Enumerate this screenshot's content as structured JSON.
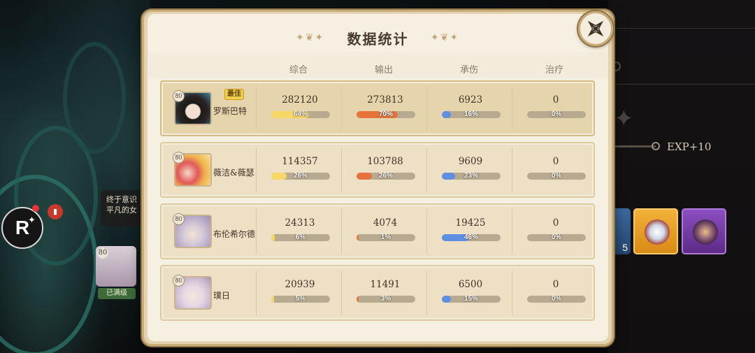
{
  "panel": {
    "title": "数据统计",
    "columns": [
      "综合",
      "输出",
      "承伤",
      "治疗"
    ],
    "best_label": "最佳",
    "rows": [
      {
        "name": "罗斯巴特",
        "level": "80",
        "best": true,
        "stats": [
          {
            "value": "282120",
            "pct": "64%",
            "fraction": 0.64,
            "color": "yellow"
          },
          {
            "value": "273813",
            "pct": "70%",
            "fraction": 0.7,
            "color": "orange"
          },
          {
            "value": "6923",
            "pct": "16%",
            "fraction": 0.16,
            "color": "blue"
          },
          {
            "value": "0",
            "pct": "0%",
            "fraction": 0,
            "color": "yellow"
          }
        ]
      },
      {
        "name": "薇洁&薇瑟",
        "level": "80",
        "best": false,
        "stats": [
          {
            "value": "114357",
            "pct": "26%",
            "fraction": 0.26,
            "color": "yellow"
          },
          {
            "value": "103788",
            "pct": "26%",
            "fraction": 0.26,
            "color": "orange"
          },
          {
            "value": "9609",
            "pct": "23%",
            "fraction": 0.23,
            "color": "blue"
          },
          {
            "value": "0",
            "pct": "0%",
            "fraction": 0,
            "color": "yellow"
          }
        ]
      },
      {
        "name": "布伦希尔德",
        "level": "80",
        "best": false,
        "stats": [
          {
            "value": "24313",
            "pct": "6%",
            "fraction": 0.06,
            "color": "yellow"
          },
          {
            "value": "4074",
            "pct": "1%",
            "fraction": 0.01,
            "color": "orange"
          },
          {
            "value": "19425",
            "pct": "46%",
            "fraction": 0.46,
            "color": "blue"
          },
          {
            "value": "0",
            "pct": "0%",
            "fraction": 0,
            "color": "yellow"
          }
        ]
      },
      {
        "name": "璞日",
        "level": "80",
        "best": false,
        "stats": [
          {
            "value": "20939",
            "pct": "5%",
            "fraction": 0.05,
            "color": "yellow"
          },
          {
            "value": "11491",
            "pct": "3%",
            "fraction": 0.03,
            "color": "orange"
          },
          {
            "value": "6500",
            "pct": "15%",
            "fraction": 0.15,
            "color": "blue"
          },
          {
            "value": "0",
            "pct": "0%",
            "fraction": 0,
            "color": "yellow"
          }
        ]
      }
    ]
  },
  "background": {
    "exp_label": "EXP+10",
    "dialog_text": "终于意识 平凡的女",
    "item_count": "5",
    "owned_tag": "已满级",
    "bg_char_level": "80",
    "r_button_label": "R"
  },
  "colors": {
    "yellow": "#f7d765",
    "orange": "#e8733a",
    "blue": "#5f8fe0",
    "panel_bg": "#f6f0e3",
    "frame": "#c9ad7a"
  },
  "icons": [
    "close-icon",
    "r-sparkle-icon",
    "book-icon",
    "star-icon"
  ]
}
